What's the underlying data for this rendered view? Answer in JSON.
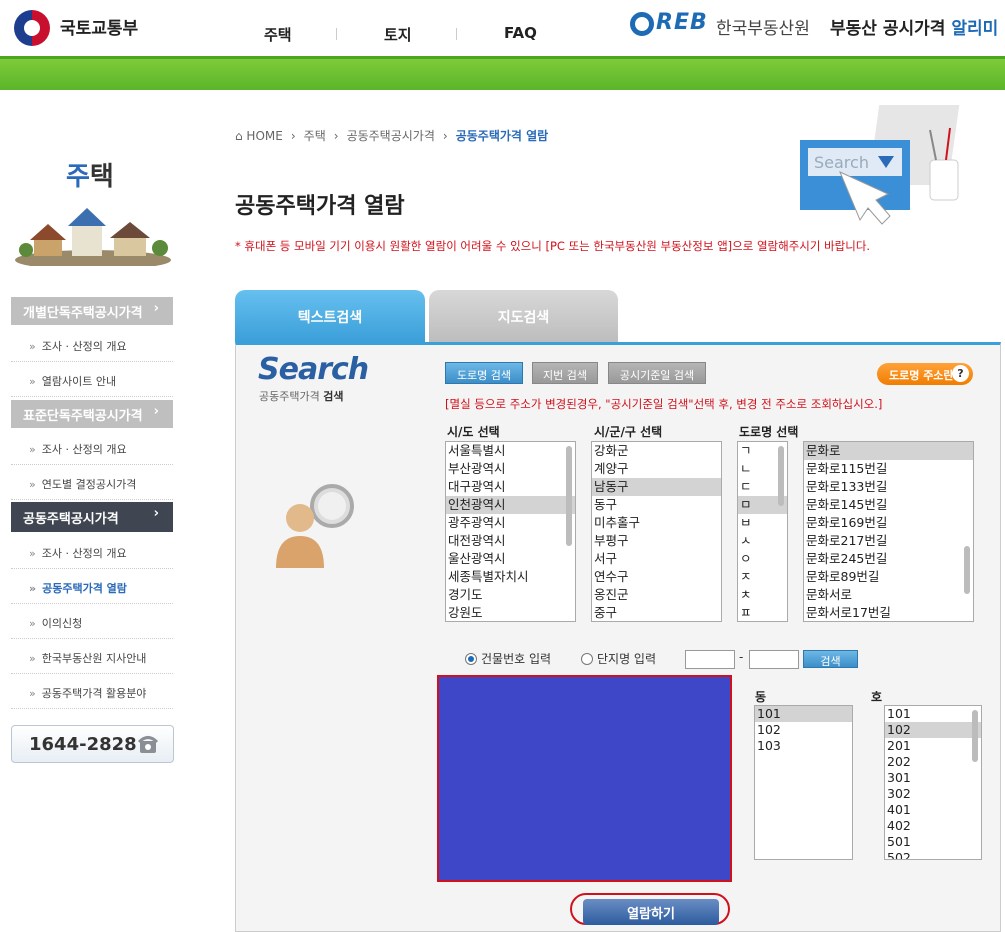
{
  "header": {
    "ministry": "국토교통부",
    "nav": [
      "주택",
      "토지",
      "FAQ"
    ],
    "reb_logo": "REB",
    "reb_name": "한국부동산원",
    "service_prefix": "부동산 공시가격",
    "service_highlight": "알리미"
  },
  "sidebar": {
    "title_first": "주",
    "title_rest": "택",
    "sections": [
      {
        "label": "개별단독주택공시가격",
        "arrow": "›",
        "items": [
          "조사 · 산정의 개요",
          "열람사이트 안내"
        ]
      },
      {
        "label": "표준단독주택공시가격",
        "arrow": "›",
        "items": [
          "조사 · 산정의 개요",
          "연도별 결정공시가격"
        ]
      },
      {
        "label": "공동주택공시가격",
        "arrow": "›",
        "items": [
          "조사 · 산정의 개요",
          "공동주택가격 열람",
          "이의신청",
          "한국부동산원 지사안내",
          "공동주택가격 활용분야"
        ]
      }
    ],
    "bullet": "»",
    "phone": "1644-2828"
  },
  "breadcrumb": [
    "⌂ HOME",
    "›",
    "주택",
    "›",
    "공동주택공시가격",
    "›",
    "공동주택가격 열람"
  ],
  "page": {
    "title": "공동주택가격 열람",
    "notice": "* 휴대폰 등 모바일 기기 이용시 원활한 열람이 어려울 수 있으니 [PC 또는 한국부동산원 부동산정보 앱]으로 열람해주시기 바랍니다.",
    "deco_search_text": "Search"
  },
  "tabs": [
    "텍스트검색",
    "지도검색"
  ],
  "search": {
    "word": "Search",
    "sub_normal": "공동주택가격",
    "sub_bold": "검색",
    "buttons": [
      "도로명 검색",
      "지번 검색",
      "공시기준일 검색"
    ],
    "addr_button": "도로명 주소란",
    "addr_icon": "?",
    "warning": "[멸실 등으로 주소가 변경된경우, \"공시기준일 검색\"선택 후, 변경 전 주소로 조회하십시오.]",
    "col_headers": [
      "시/도 선택",
      "시/군/구 선택",
      "도로명 선택"
    ],
    "sido": [
      "서울특별시",
      "부산광역시",
      "대구광역시",
      "인천광역시",
      "광주광역시",
      "대전광역시",
      "울산광역시",
      "세종특별자치시",
      "경기도",
      "강원도"
    ],
    "sido_selected": 3,
    "sigungu": [
      "강화군",
      "계양구",
      "남동구",
      "동구",
      "미추홀구",
      "부평구",
      "서구",
      "연수구",
      "옹진군",
      "중구"
    ],
    "sigungu_selected": 2,
    "initials": [
      "ㄱ",
      "ㄴ",
      "ㄷ",
      "ㅁ",
      "ㅂ",
      "ㅅ",
      "ㅇ",
      "ㅈ",
      "ㅊ",
      "ㅍ"
    ],
    "initials_selected": 3,
    "roads": [
      "문화로",
      "문화로115번길",
      "문화로133번길",
      "문화로145번길",
      "문화로169번길",
      "문화로217번길",
      "문화로245번길",
      "문화로89번길",
      "문화서로",
      "문화서로17번길"
    ],
    "roads_selected": 0,
    "radio_building": "건물번호 입력",
    "radio_complex": "단지명 입력",
    "dash": "-",
    "search_button": "검색",
    "dong_header": "동",
    "ho_header": "호",
    "dong": [
      "101",
      "102",
      "103"
    ],
    "dong_selected": 0,
    "ho": [
      "101",
      "102",
      "201",
      "202",
      "301",
      "302",
      "401",
      "402",
      "501",
      "502"
    ],
    "ho_selected": 1,
    "view_button": "열람하기"
  },
  "colors": {
    "accent": "#2a6ab8",
    "green": "#5bb52a",
    "red": "#d0111b",
    "viewer": "#3d47c8"
  }
}
